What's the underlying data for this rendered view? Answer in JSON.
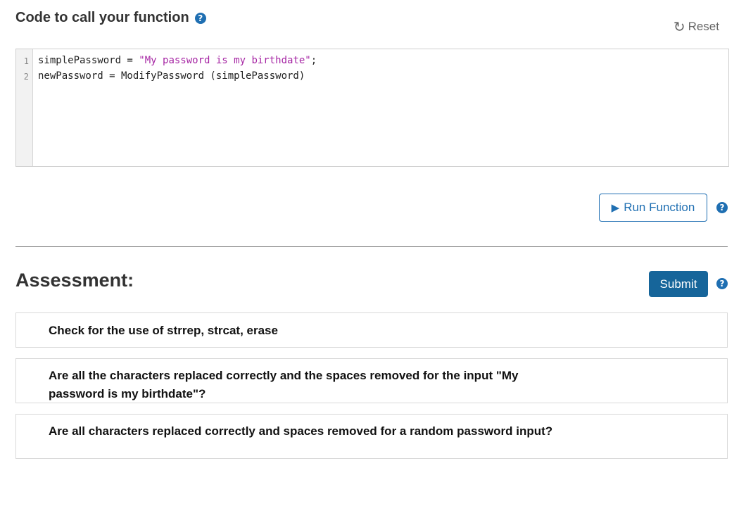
{
  "code_section": {
    "title": "Code to call your function",
    "help_icon": "question-circle-icon",
    "reset_label": "Reset",
    "reset_icon": "refresh-icon"
  },
  "editor": {
    "lines": [
      {
        "number": "1",
        "text_before": "simplePassword = ",
        "string_literal": "\"My password is my birthdate\"",
        "text_after": ";"
      },
      {
        "number": "2",
        "text_before": "newPassword = ModifyPassword (simplePassword)",
        "string_literal": "",
        "text_after": ""
      }
    ],
    "string_color": "#a626a4"
  },
  "run": {
    "label": "Run Function",
    "icon": "play-icon"
  },
  "assessment": {
    "title": "Assessment:",
    "submit_label": "Submit",
    "criteria": [
      {
        "text": " Check for the use of strrep, strcat, erase"
      },
      {
        "text": " Are all the characters replaced correctly and the spaces removed for the input \"My password is my birthdate\"?"
      },
      {
        "text": " Are all characters replaced correctly and spaces removed for a random password input?"
      }
    ]
  },
  "colors": {
    "accent": "#1f6fb2",
    "submit_bg": "#16659a"
  }
}
